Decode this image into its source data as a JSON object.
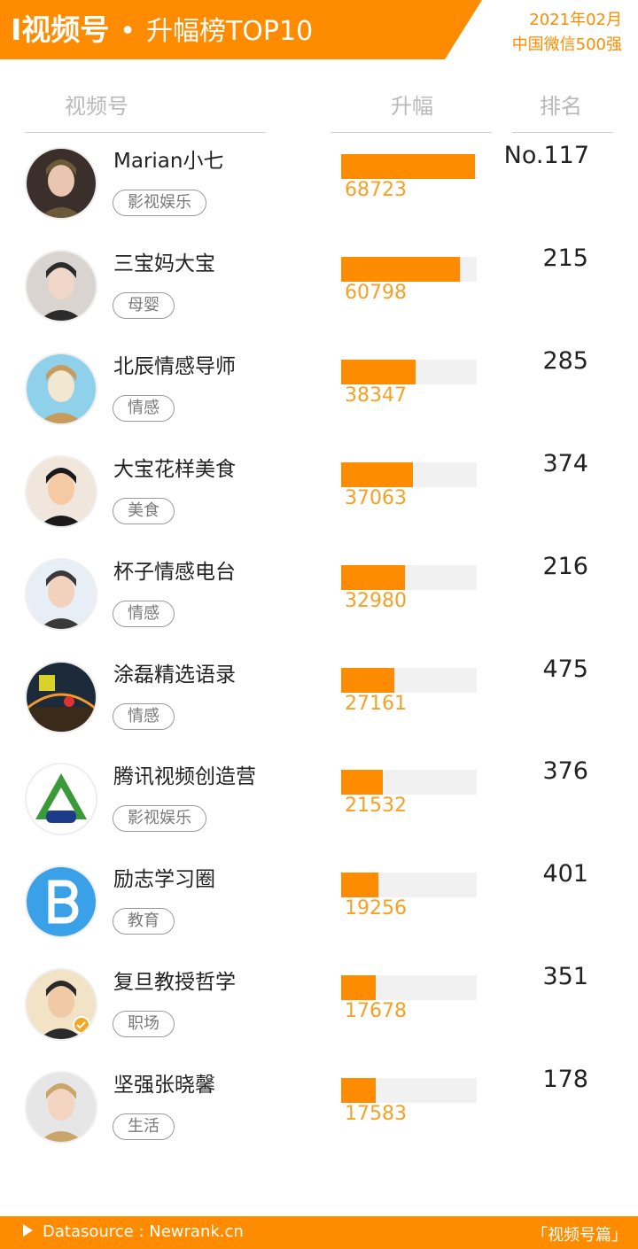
{
  "header": {
    "title_strong": "I视频号",
    "title_dot": "•",
    "title_sub": "升幅榜TOP10",
    "date": "2021年02月",
    "scope": "中国微信500强",
    "brand_color": "#ff8c00"
  },
  "columns": {
    "account": "视频号",
    "rise": "升幅",
    "rank": "排名"
  },
  "rows": [
    {
      "name": "Marian小七",
      "tag": "影视娱乐",
      "rise": "68723",
      "rank": "No.117",
      "fill": 1.0,
      "avatar_icon": "avatar-woman-photo"
    },
    {
      "name": "三宝妈大宝",
      "tag": "母婴",
      "rise": "60798",
      "rank": "215",
      "fill": 0.885,
      "avatar_icon": "avatar-woman-photo"
    },
    {
      "name": "北辰情感导师",
      "tag": "情感",
      "rise": "38347",
      "rank": "285",
      "fill": 0.558,
      "avatar_icon": "avatar-beach-photo"
    },
    {
      "name": "大宝花样美食",
      "tag": "美食",
      "rise": "37063",
      "rank": "374",
      "fill": 0.539,
      "avatar_icon": "avatar-chef-photo"
    },
    {
      "name": "杯子情感电台",
      "tag": "情感",
      "rise": "32980",
      "rank": "216",
      "fill": 0.48,
      "avatar_icon": "avatar-woman-photo"
    },
    {
      "name": "涂磊精选语录",
      "tag": "情感",
      "rise": "27161",
      "rank": "475",
      "fill": 0.395,
      "avatar_icon": "avatar-bridge-logo"
    },
    {
      "name": "腾讯视频创造营",
      "tag": "影视娱乐",
      "rise": "21532",
      "rank": "376",
      "fill": 0.313,
      "avatar_icon": "avatar-triangle-logo"
    },
    {
      "name": "励志学习圈",
      "tag": "教育",
      "rise": "19256",
      "rank": "401",
      "fill": 0.28,
      "avatar_icon": "avatar-letter-b-logo"
    },
    {
      "name": "复旦教授哲学",
      "tag": "职场",
      "rise": "17678",
      "rank": "351",
      "fill": 0.257,
      "avatar_icon": "avatar-woman-verified"
    },
    {
      "name": "坚强张晓馨",
      "tag": "生活",
      "rise": "17583",
      "rank": "178",
      "fill": 0.256,
      "avatar_icon": "avatar-woman-photo"
    }
  ],
  "footer": {
    "source": "Datasource : Newrank.cn",
    "category": "「视频号篇」"
  }
}
